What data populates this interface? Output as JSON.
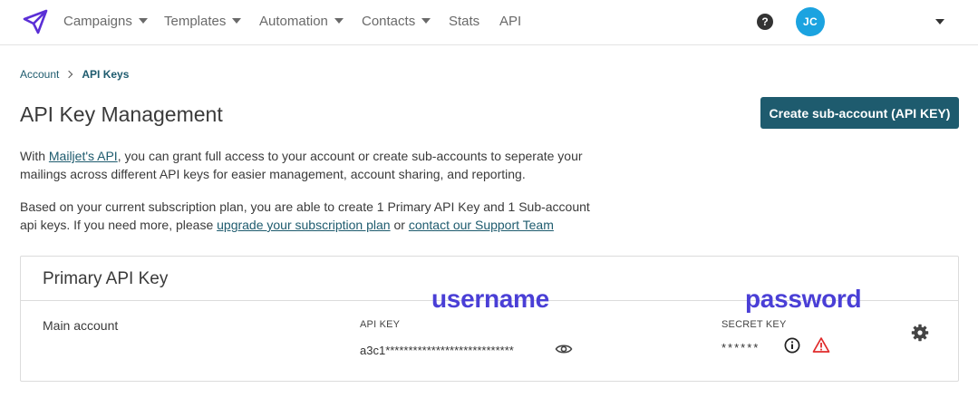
{
  "nav": {
    "logo_icon": "paper-plane-icon",
    "items": [
      {
        "label": "Campaigns",
        "dropdown": true
      },
      {
        "label": "Templates",
        "dropdown": true
      },
      {
        "label": "Automation",
        "dropdown": true
      },
      {
        "label": "Contacts",
        "dropdown": true
      },
      {
        "label": "Stats",
        "dropdown": false
      },
      {
        "label": "API",
        "dropdown": false
      }
    ],
    "help_glyph": "?",
    "avatar_initials": "JC"
  },
  "breadcrumb": {
    "parent": "Account",
    "current": "API Keys"
  },
  "page": {
    "title": "API Key Management",
    "create_button": "Create sub-account (API KEY)",
    "intro": {
      "prefix": "With ",
      "link": "Mailjet's API",
      "suffix": ", you can grant full access to your account or create sub-accounts to seperate your mailings across different API keys for easier management, account sharing, and reporting."
    },
    "plan": {
      "text": "Based on your current subscription plan, you are able to create 1 Primary API Key and 1 Sub-account api keys. If you need more, please ",
      "link1": "upgrade your subscription plan",
      "middle": " or ",
      "link2": "contact our Support Team"
    }
  },
  "primary_key": {
    "title": "Primary API Key",
    "account_name": "Main account",
    "api_key_label": "API KEY",
    "api_key_value": "a3c1****************************",
    "secret_key_label": "SECRET KEY",
    "secret_key_value": "******"
  },
  "annotations": {
    "username": "username",
    "password": "password"
  },
  "colors": {
    "brand_teal": "#1e5b6e",
    "avatar_blue": "#1ba3e0",
    "logo_purple": "#5b2fd6",
    "annotation_blue": "#4a3fd6",
    "warning_red": "#e02b2b"
  }
}
